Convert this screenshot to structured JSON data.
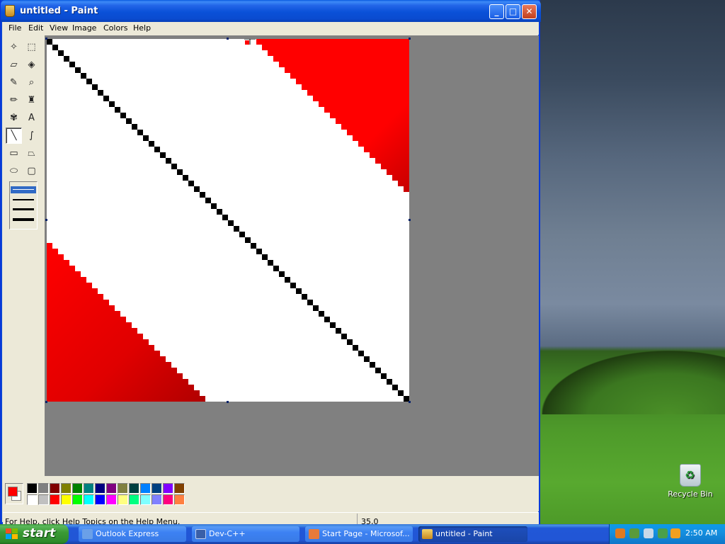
{
  "window": {
    "title": "untitled - Paint",
    "controls": {
      "minimize": "_",
      "maximize": "□",
      "close": "✕"
    }
  },
  "menu": [
    "File",
    "Edit",
    "View",
    "Image",
    "Colors",
    "Help"
  ],
  "toolbox": {
    "tools": [
      {
        "name": "free-form-select",
        "glyph": "✧"
      },
      {
        "name": "rect-select",
        "glyph": "⬚"
      },
      {
        "name": "eraser",
        "glyph": "▱"
      },
      {
        "name": "fill",
        "glyph": "◈"
      },
      {
        "name": "pick-color",
        "glyph": "✎"
      },
      {
        "name": "magnifier",
        "glyph": "⌕"
      },
      {
        "name": "pencil",
        "glyph": "✏"
      },
      {
        "name": "brush",
        "glyph": "♜"
      },
      {
        "name": "airbrush",
        "glyph": "✾"
      },
      {
        "name": "text",
        "glyph": "A"
      },
      {
        "name": "line",
        "glyph": "╲"
      },
      {
        "name": "curve",
        "glyph": "∫"
      },
      {
        "name": "rectangle",
        "glyph": "▭"
      },
      {
        "name": "polygon",
        "glyph": "⏢"
      },
      {
        "name": "ellipse",
        "glyph": "⬭"
      },
      {
        "name": "rounded-rectangle",
        "glyph": "▢"
      }
    ],
    "active_tool": "line",
    "selected_width": 1
  },
  "colors": {
    "foreground": "#ff0000",
    "background": "#ffffff",
    "palette_top": [
      "#000000",
      "#808080",
      "#800000",
      "#808000",
      "#008000",
      "#008080",
      "#000080",
      "#800080",
      "#808040",
      "#004040",
      "#0080ff",
      "#004080",
      "#8000ff",
      "#804000"
    ],
    "palette_bottom": [
      "#ffffff",
      "#c0c0c0",
      "#ff0000",
      "#ffff00",
      "#00ff00",
      "#00ffff",
      "#0000ff",
      "#ff00ff",
      "#ffff80",
      "#00ff80",
      "#80ffff",
      "#8080ff",
      "#ff0080",
      "#ff8040"
    ]
  },
  "canvas": {
    "background": "#ffffff",
    "shapes": [
      {
        "type": "diagonal-line",
        "color": "#000000"
      },
      {
        "type": "triangle-top-right",
        "color": "#ff0000"
      },
      {
        "type": "triangle-bottom-left",
        "color": "#ff0000"
      }
    ]
  },
  "status": {
    "help_text": "For Help, click Help Topics on the Help Menu.",
    "coords": "35,0"
  },
  "desktop": {
    "recycle_bin_label": "Recycle Bin"
  },
  "taskbar": {
    "start_label": "start",
    "tasks": [
      {
        "label": "Outlook Express",
        "active": false
      },
      {
        "label": "Dev-C++",
        "active": false
      },
      {
        "label": "Start Page - Microsof...",
        "active": false
      },
      {
        "label": "untitled - Paint",
        "active": true
      }
    ],
    "time": "2:50 AM"
  }
}
